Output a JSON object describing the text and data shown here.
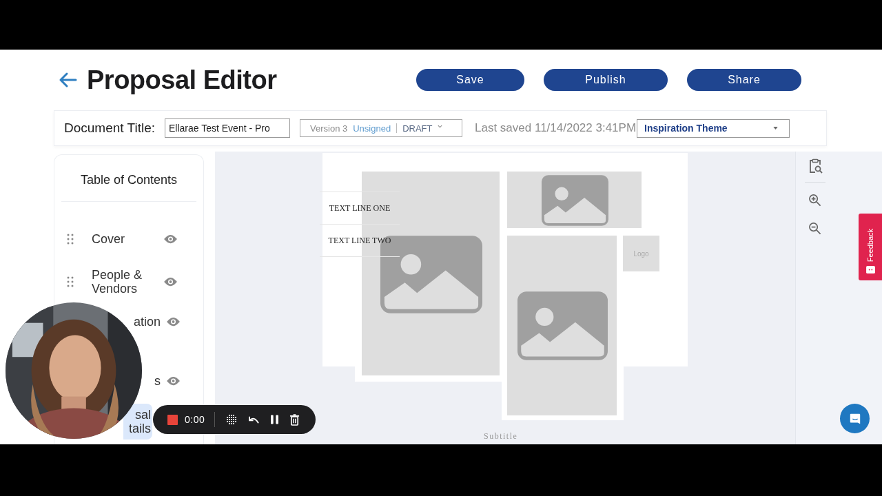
{
  "header": {
    "title": "Proposal Editor",
    "buttons": [
      "Save",
      "Publish",
      "Share"
    ]
  },
  "toolbar": {
    "document_title_label": "Document Title:",
    "document_title_value": "Ellarae Test Event - Pro",
    "version": "Version 3",
    "signature_status": "Unsigned",
    "status": "DRAFT",
    "last_saved": "Last saved 11/14/2022 3:41PM",
    "theme": "Inspiration Theme"
  },
  "toc": {
    "title": "Table of Contents",
    "items": [
      {
        "lines": [
          "Cover"
        ],
        "handle": true,
        "selected": false
      },
      {
        "lines": [
          "People &",
          "Vendors"
        ],
        "handle": true,
        "selected": false
      },
      {
        "lines": [
          "ation"
        ],
        "handle": false,
        "selected": false
      },
      {
        "lines": [
          "s"
        ],
        "handle": false,
        "selected": false
      },
      {
        "lines": [
          "sal",
          "tails"
        ],
        "handle": false,
        "selected": true
      }
    ]
  },
  "canvas": {
    "text_lines": [
      "TEXT LINE ONE",
      "TEXT LINE TWO"
    ],
    "logo": "Logo",
    "subtitle": "Subtitle"
  },
  "recorder": {
    "time": "0:00"
  },
  "feedback": {
    "label": "Feedback"
  }
}
